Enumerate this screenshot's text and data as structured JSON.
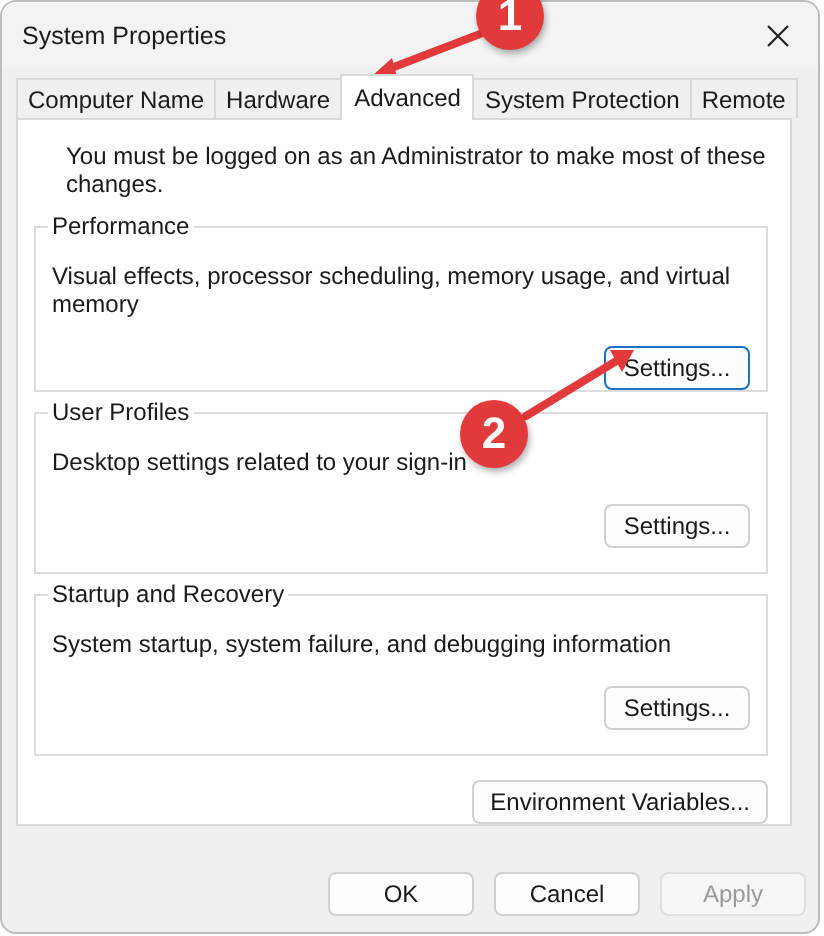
{
  "window": {
    "title": "System Properties"
  },
  "tabs": [
    {
      "label": "Computer Name",
      "selected": false
    },
    {
      "label": "Hardware",
      "selected": false
    },
    {
      "label": "Advanced",
      "selected": true
    },
    {
      "label": "System Protection",
      "selected": false
    },
    {
      "label": "Remote",
      "selected": false
    }
  ],
  "note": "You must be logged on as an Administrator to make most of these changes.",
  "groups": [
    {
      "title": "Performance",
      "description": "Visual effects, processor scheduling, memory usage, and virtual memory",
      "button": "Settings..."
    },
    {
      "title": "User Profiles",
      "description": "Desktop settings related to your sign-in",
      "button": "Settings..."
    },
    {
      "title": "Startup and Recovery",
      "description": "System startup, system failure, and debugging information",
      "button": "Settings..."
    }
  ],
  "environment_button": "Environment Variables...",
  "buttons": [
    {
      "label": "OK",
      "disabled": false
    },
    {
      "label": "Cancel",
      "disabled": false
    },
    {
      "label": "Apply",
      "disabled": true
    }
  ],
  "annotations": [
    {
      "number": "1"
    },
    {
      "number": "2"
    }
  ]
}
